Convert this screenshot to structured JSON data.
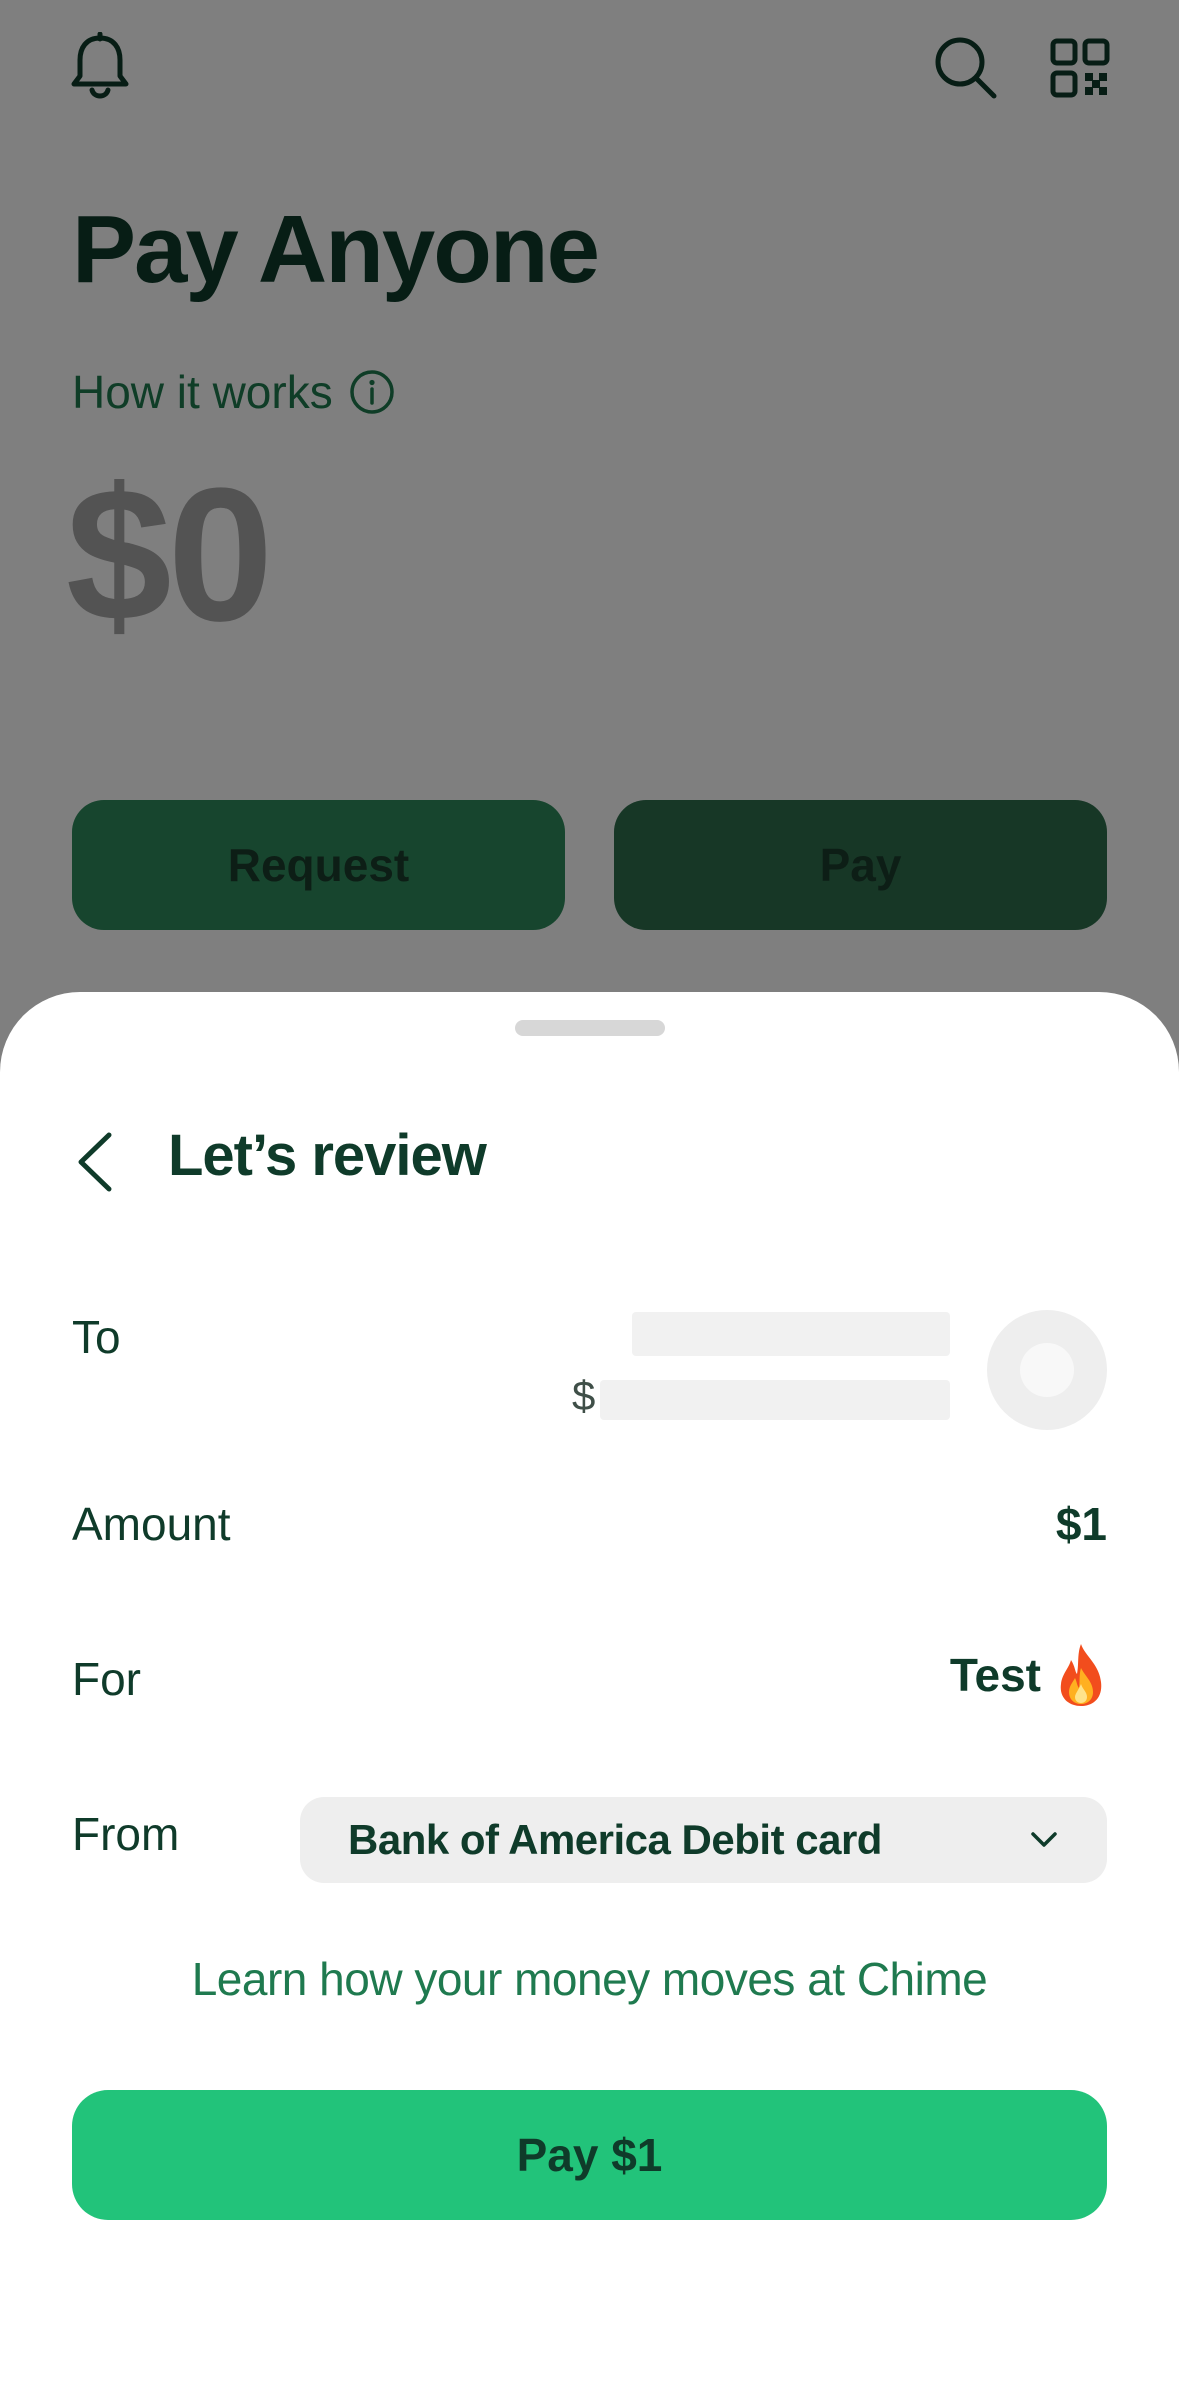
{
  "background": {
    "page_title": "Pay Anyone",
    "how_it_works": "How it works",
    "amount": "$0",
    "request_button": "Request",
    "pay_button": "Pay"
  },
  "sheet": {
    "title": "Let’s review",
    "to_label": "To",
    "to_currency_symbol": "$",
    "amount_label": "Amount",
    "amount_value": "$1",
    "for_label": "For",
    "for_value": "Test",
    "from_label": "From",
    "from_value": "Bank of America Debit card",
    "learn_link": "Learn how your money moves at Chime",
    "pay_button": "Pay $1"
  },
  "icons": {
    "bell": "bell-icon",
    "search": "search-icon",
    "qr": "qr-code-icon",
    "info": "info-icon",
    "back": "chevron-left-icon",
    "dropdown": "chevron-down-icon",
    "emoji": "fire-emoji-icon"
  },
  "colors": {
    "brand_green": "#22c37a",
    "dark_green_text": "#0f3b2a",
    "link_green": "#1f7a4f",
    "overlay": "rgba(0,0,0,0.5)"
  }
}
